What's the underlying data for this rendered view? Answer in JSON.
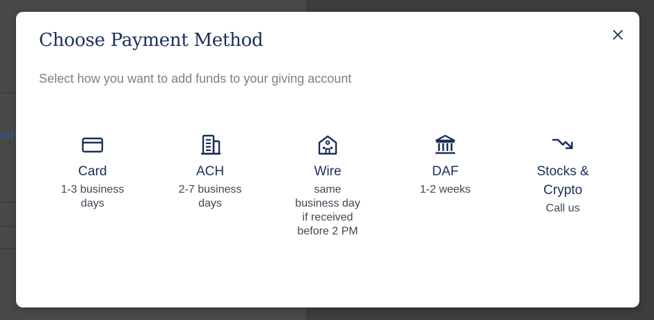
{
  "modal": {
    "title": "Choose Payment Method",
    "subtitle": "Select how you want to add funds to your giving account",
    "close_icon": "close-icon"
  },
  "background": {
    "partial_link_text": "ed"
  },
  "options": [
    {
      "label": "Card",
      "desc": "1-3 business days",
      "icon": "credit-card-icon"
    },
    {
      "label": "ACH",
      "desc": "2-7 business days",
      "icon": "building-icon"
    },
    {
      "label": "Wire",
      "desc": "same business day if received before 2 PM",
      "icon": "bank-building-icon"
    },
    {
      "label": "DAF",
      "desc": "1-2 weeks",
      "icon": "institution-columns-icon"
    },
    {
      "label": "Stocks & Crypto",
      "desc": "Call us",
      "icon": "trending-down-arrow-icon"
    }
  ],
  "colors": {
    "primary_navy": "#1a2e5a",
    "subtitle_gray": "#7c8088",
    "desc_gray": "#3f4652",
    "overlay": "#3d3d3d"
  }
}
